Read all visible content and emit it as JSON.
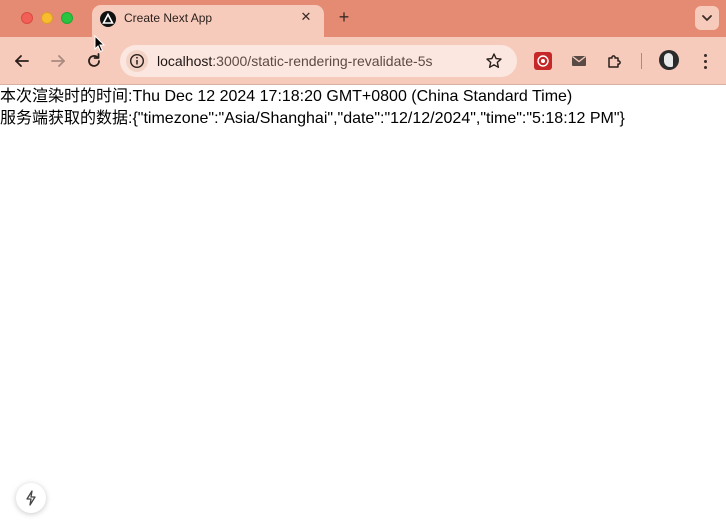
{
  "tab": {
    "title": "Create Next App",
    "close_label": "✕",
    "new_tab_label": "+"
  },
  "address": {
    "host": "localhost",
    "path": ":3000/static-rendering-revalidate-5s"
  },
  "page": {
    "render_time_line": "本次渲染时的时间:Thu Dec 12 2024 17:18:20 GMT+0800 (China Standard Time)",
    "server_data_line": "服务端获取的数据:{\"timezone\":\"Asia/Shanghai\",\"date\":\"12/12/2024\",\"time\":\"5:18:12 PM\"}"
  },
  "colors": {
    "tab_strip": "#e68b73",
    "toolbar": "#f7cbbb",
    "omnibox": "#fbe7df"
  },
  "icons": {
    "back": "arrow-left-icon",
    "forward": "arrow-right-icon",
    "reload": "reload-icon",
    "site_info": "site-info-icon",
    "bookmark": "star-icon",
    "extensions": "puzzle-icon",
    "menu": "kebab-menu-icon",
    "badge": "nextjs-lightning-icon"
  }
}
